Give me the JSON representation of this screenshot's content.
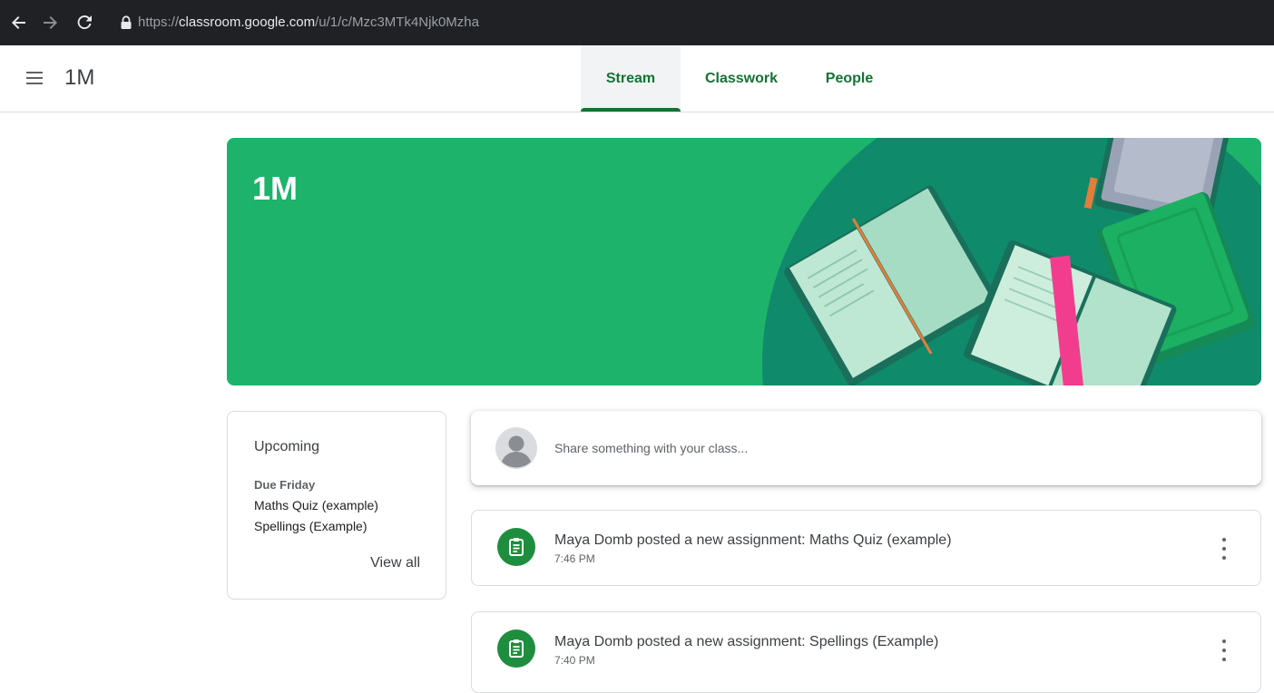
{
  "browser": {
    "url_scheme": "https://",
    "url_host": "classroom.google.com",
    "url_path": "/u/1/c/Mzc3MTk4Njk0Mzha"
  },
  "header": {
    "class_name": "1M",
    "tabs": [
      {
        "label": "Stream",
        "active": true
      },
      {
        "label": "Classwork",
        "active": false
      },
      {
        "label": "People",
        "active": false
      }
    ]
  },
  "banner": {
    "title": "1M"
  },
  "upcoming": {
    "title": "Upcoming",
    "due_label": "Due Friday",
    "items": [
      "Maths Quiz (example)",
      "Spellings (Example)"
    ],
    "view_all": "View all"
  },
  "share": {
    "placeholder": "Share something with your class..."
  },
  "stream": {
    "posts": [
      {
        "title": "Maya Domb posted a new assignment: Maths Quiz (example)",
        "time": "7:46 PM",
        "icon": "assignment-icon"
      },
      {
        "title": "Maya Domb posted a new assignment: Spellings (Example)",
        "time": "7:40 PM",
        "icon": "assignment-icon"
      }
    ]
  },
  "colors": {
    "brand_green": "#137333",
    "banner_green": "#1db36b",
    "banner_dark": "#0f8a6a",
    "icon_green": "#1e8e3e"
  }
}
